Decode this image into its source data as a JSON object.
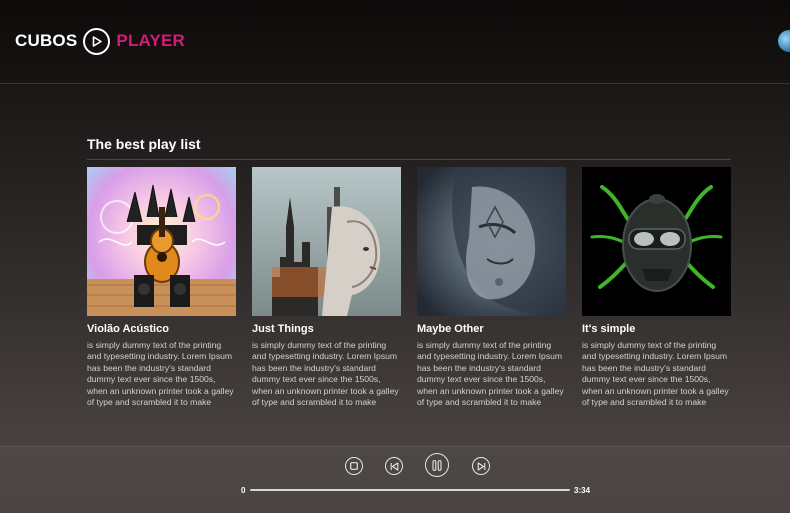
{
  "brand": {
    "first": "CUBOS",
    "second": "PLAYER",
    "accent_color": "#d31b78"
  },
  "section": {
    "title": "The best play list"
  },
  "playlists": [
    {
      "title": "Violão Acústico",
      "description": "is simply dummy text of the printing and typesetting industry. Lorem Ipsum has been the industry's standard dummy text ever since the 1500s, when an unknown printer took a galley of type and scrambled it to make"
    },
    {
      "title": "Just Things",
      "description": "is simply dummy text of the printing and typesetting industry. Lorem Ipsum has been the industry's standard dummy text ever since the 1500s, when an unknown printer took a galley of type and scrambled it to make"
    },
    {
      "title": "Maybe Other",
      "description": "is simply dummy text of the printing and typesetting industry. Lorem Ipsum has been the industry's standard dummy text ever since the 1500s, when an unknown printer took a galley of type and scrambled it to make"
    },
    {
      "title": "It's simple",
      "description": "is simply dummy text of the printing and typesetting industry. Lorem Ipsum has been the industry's standard dummy text ever since the 1500s, when an unknown printer took a galley of type and scrambled it to make"
    }
  ],
  "player": {
    "current_time": "0",
    "total_time": "3:34",
    "progress": 0,
    "controls": [
      "stop-icon",
      "previous-icon",
      "pause-icon",
      "next-icon"
    ]
  }
}
